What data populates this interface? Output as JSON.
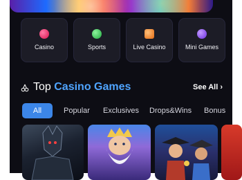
{
  "colors": {
    "background": "#0d0d14",
    "card": "#1c1c26",
    "accent": "#4fa4ff",
    "active_tab": "#3c86e8"
  },
  "categories": [
    {
      "label": "Casino",
      "icon": "cherry-icon",
      "color": "#ff3c78"
    },
    {
      "label": "Sports",
      "icon": "soccer-ball-icon",
      "color": "#36d65a"
    },
    {
      "label": "Live Casino",
      "icon": "dice-icon",
      "color": "#ff8a2b"
    },
    {
      "label": "Mini Games",
      "icon": "gamepad-icon",
      "color": "#9d5cff"
    }
  ],
  "section": {
    "title_prefix": "Top",
    "title_accent": "Casino Games",
    "see_all": "See All",
    "see_all_icon": "chevron-right-icon"
  },
  "tabs": [
    "All",
    "Popular",
    "Exclusives",
    "Drops&Wins",
    "Bonus"
  ],
  "active_tab": "All",
  "games": [
    {
      "name": "game-tile-1",
      "art": "dark armored warrior"
    },
    {
      "name": "game-tile-2",
      "art": "bearded god"
    },
    {
      "name": "game-tile-3",
      "art": "pirate characters"
    },
    {
      "name": "game-tile-4",
      "art": "red artwork"
    }
  ]
}
